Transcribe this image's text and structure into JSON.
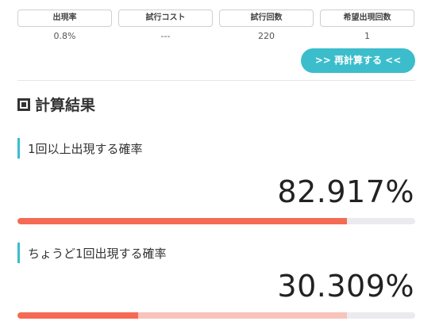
{
  "params": [
    {
      "label": "出現率",
      "value": "0.8%"
    },
    {
      "label": "試行コスト",
      "value": "---"
    },
    {
      "label": "試行回数",
      "value": "220"
    },
    {
      "label": "希望出現回数",
      "value": "1"
    }
  ],
  "recalc_label": ">> 再計算する <<",
  "section_title": "計算結果",
  "results": [
    {
      "label": "1回以上出現する確率",
      "value": "82.917%",
      "fill_fraction": 0.82917
    },
    {
      "label": "ちょうど1回出現する確率",
      "value": "30.309%",
      "fill_fraction": 0.30309,
      "secondary_fill_fraction": 0.82917
    }
  ],
  "colors": {
    "accent": "#3cbdcb",
    "bar_fill": "#f56a55",
    "bar_fill_light": "#f8c3bb",
    "bar_track": "#ebebef"
  }
}
